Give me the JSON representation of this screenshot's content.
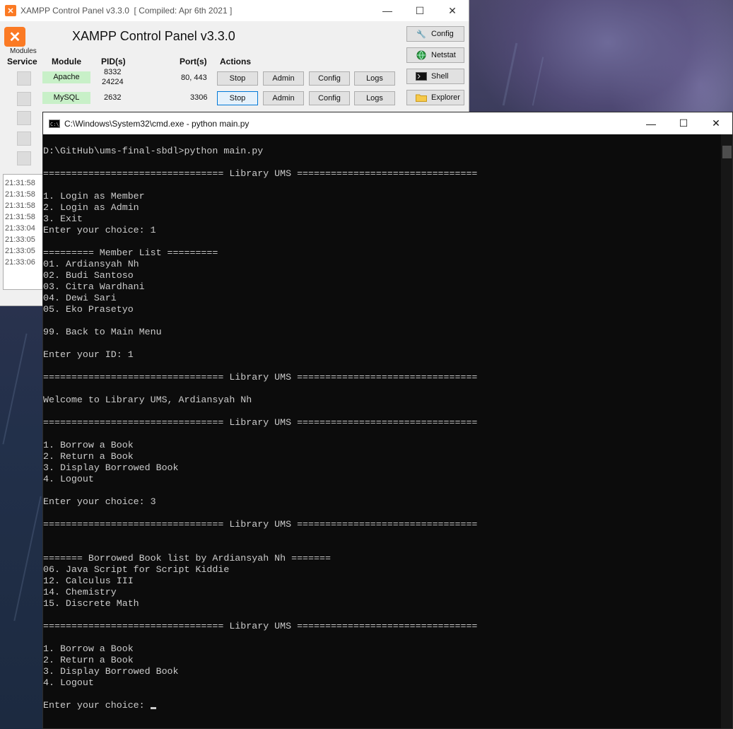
{
  "xampp": {
    "window_title": "XAMPP Control Panel v3.3.0",
    "compiled": "[ Compiled: Apr 6th 2021 ]",
    "heading": "XAMPP Control Panel v3.3.0",
    "modules_label": "Modules",
    "columns": {
      "service": "Service",
      "module": "Module",
      "pids": "PID(s)",
      "ports": "Port(s)",
      "actions": "Actions"
    },
    "rows": [
      {
        "module": "Apache",
        "pid_1": "8332",
        "pid_2": "24224",
        "ports": "80, 443",
        "stop": "Stop",
        "admin": "Admin",
        "config": "Config",
        "logs": "Logs"
      },
      {
        "module": "MySQL",
        "pid_1": "2632",
        "pid_2": "",
        "ports": "3306",
        "stop": "Stop",
        "admin": "Admin",
        "config": "Config",
        "logs": "Logs"
      }
    ],
    "side_buttons": {
      "config": "Config",
      "netstat": "Netstat",
      "shell": "Shell",
      "explorer": "Explorer"
    },
    "log_times": [
      "21:31:58",
      "21:31:58",
      "21:31:58",
      "21:31:58",
      "21:33:04",
      "21:33:05",
      "21:33:05",
      "21:33:06"
    ]
  },
  "cmd": {
    "window_title": "C:\\Windows\\System32\\cmd.exe - python  main.py",
    "output": "D:\\GitHub\\ums-final-sbdl>python main.py\n\n================================ Library UMS ================================\n\n1. Login as Member\n2. Login as Admin\n3. Exit\nEnter your choice: 1\n\n========= Member List =========\n01. Ardiansyah Nh\n02. Budi Santoso\n03. Citra Wardhani\n04. Dewi Sari\n05. Eko Prasetyo\n\n99. Back to Main Menu\n\nEnter your ID: 1\n\n================================ Library UMS ================================\n\nWelcome to Library UMS, Ardiansyah Nh\n\n================================ Library UMS ================================\n\n1. Borrow a Book\n2. Return a Book\n3. Display Borrowed Book\n4. Logout\n\nEnter your choice: 3\n\n================================ Library UMS ================================\n\n\n======= Borrowed Book list by Ardiansyah Nh =======\n06. Java Script for Script Kiddie\n12. Calculus III\n14. Chemistry\n15. Discrete Math\n\n================================ Library UMS ================================\n\n1. Borrow a Book\n2. Return a Book\n3. Display Borrowed Book\n4. Logout\n\nEnter your choice: "
  }
}
